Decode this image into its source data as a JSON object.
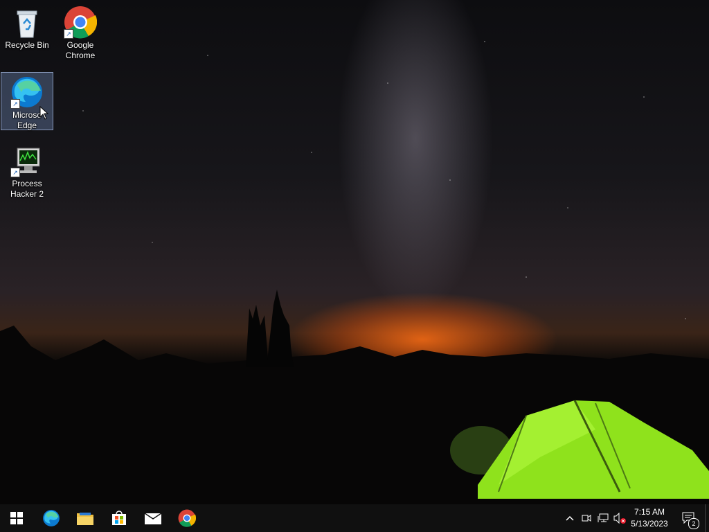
{
  "desktop": {
    "icons": [
      {
        "label": "Recycle Bin",
        "icon": "recycle-bin-icon"
      },
      {
        "label": "Google Chrome",
        "icon": "chrome-icon"
      },
      {
        "label": "Microsoft Edge",
        "display_label": "Microso\nEdge",
        "icon": "edge-icon",
        "selected": true
      },
      {
        "label": "Process Hacker 2",
        "icon": "process-hacker-icon"
      }
    ]
  },
  "taskbar": {
    "pinned": [
      {
        "name": "start",
        "icon": "windows-start-icon"
      },
      {
        "name": "edge",
        "icon": "edge-icon"
      },
      {
        "name": "file-explorer",
        "icon": "folder-icon"
      },
      {
        "name": "store",
        "icon": "store-icon"
      },
      {
        "name": "mail",
        "icon": "mail-icon"
      },
      {
        "name": "chrome",
        "icon": "chrome-icon"
      }
    ],
    "tray": {
      "time": "7:15 AM",
      "date": "5/13/2023",
      "notification_count": "2",
      "icons": [
        "chevron-up-icon",
        "meet-now-icon",
        "network-icon",
        "volume-muted-icon"
      ]
    }
  }
}
